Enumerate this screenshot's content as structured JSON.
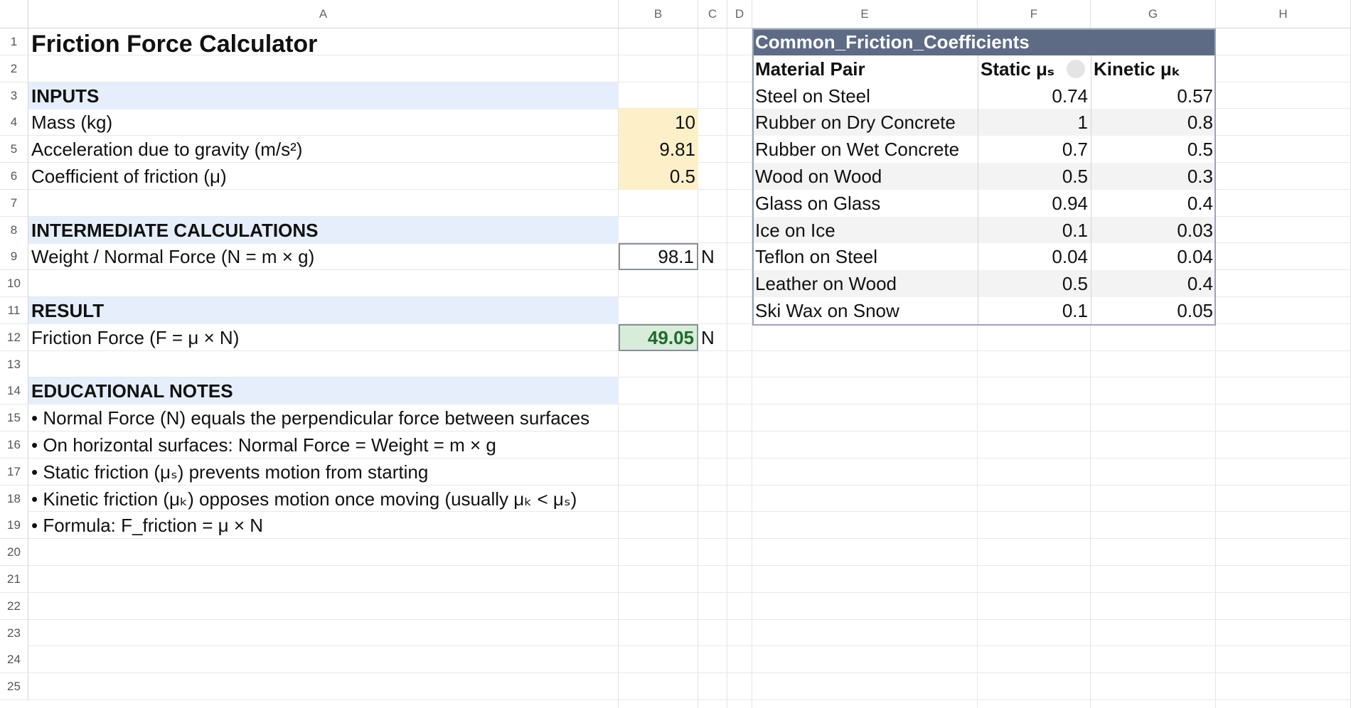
{
  "columns": [
    "A",
    "B",
    "C",
    "D",
    "E",
    "F",
    "G",
    "H"
  ],
  "rows": [
    "1",
    "2",
    "3",
    "4",
    "5",
    "6",
    "7",
    "8",
    "9",
    "10",
    "11",
    "12",
    "13",
    "14",
    "15",
    "16",
    "17",
    "18",
    "19",
    "20",
    "21",
    "22",
    "23",
    "24",
    "25"
  ],
  "sheet": {
    "title": "Friction Force Calculator",
    "inputs_header": "INPUTS",
    "mass_label": "Mass (kg)",
    "mass_value": "10",
    "gravity_label": "Acceleration due to gravity (m/s²)",
    "gravity_value": "9.81",
    "coef_label": "Coefficient of friction (μ)",
    "coef_value": "0.5",
    "intermediate_header": "INTERMEDIATE CALCULATIONS",
    "normal_label": "Weight / Normal Force (N = m × g)",
    "normal_value": "98.1",
    "normal_unit": "N",
    "result_header": "RESULT",
    "friction_label": "Friction Force (F = μ × N)",
    "friction_value": "49.05",
    "friction_unit": "N",
    "notes_header": "EDUCATIONAL NOTES",
    "notes": [
      "• Normal Force (N) equals the perpendicular force between surfaces",
      "• On horizontal surfaces: Normal Force = Weight = m × g",
      "• Static friction (μₛ) prevents motion from starting",
      "• Kinetic friction (μₖ) opposes motion once moving (usually μₖ < μₛ)",
      "• Formula: F_friction = μ × N"
    ]
  },
  "reference": {
    "title": "Common_Friction_Coefficients",
    "headers": [
      "Material Pair",
      "Static μₛ",
      "Kinetic μₖ"
    ],
    "rows": [
      [
        "Steel on Steel",
        "0.74",
        "0.57"
      ],
      [
        "Rubber on Dry Concrete",
        "1",
        "0.8"
      ],
      [
        "Rubber on Wet Concrete",
        "0.7",
        "0.5"
      ],
      [
        "Wood on Wood",
        "0.5",
        "0.3"
      ],
      [
        "Glass on Glass",
        "0.94",
        "0.4"
      ],
      [
        "Ice on Ice",
        "0.1",
        "0.03"
      ],
      [
        "Teflon on Steel",
        "0.04",
        "0.04"
      ],
      [
        "Leather on Wood",
        "0.5",
        "0.4"
      ],
      [
        "Ski Wax on Snow",
        "0.1",
        "0.05"
      ]
    ]
  },
  "colors": {
    "section_fill": "#e6eefb",
    "input_fill": "#fdf0c9",
    "result_fill": "#d7ecd9",
    "result_text": "#1e6b2c",
    "table_header_fill": "#5d6b85"
  }
}
